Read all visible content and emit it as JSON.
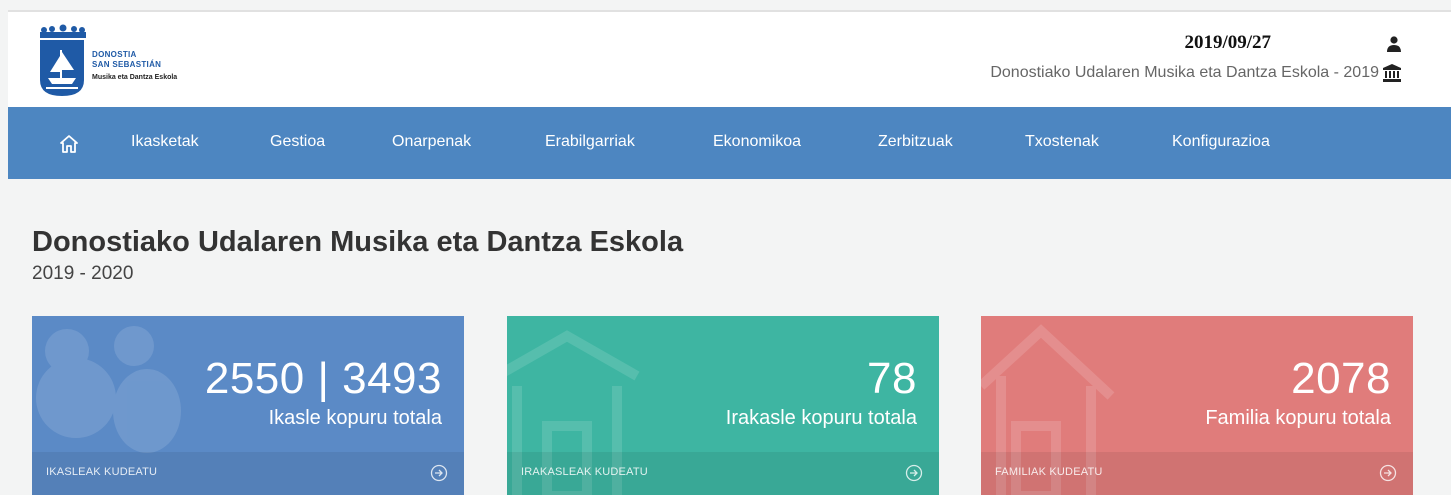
{
  "header": {
    "logo": {
      "line1": "DONOSTIA",
      "line2": "SAN SEBASTIÁN",
      "line3": "Musika eta Dantza Eskola"
    },
    "date": "2019/09/27",
    "subtitle": "Donostiako Udalaren Musika eta Dantza Eskola - 2019",
    "icons": [
      "user-icon",
      "bank-icon"
    ]
  },
  "nav": {
    "home_icon": "home-icon",
    "items": [
      "Ikasketak",
      "Gestioa",
      "Onarpenak",
      "Erabilgarriak",
      "Ekonomikoa",
      "Zerbitzuak",
      "Txostenak",
      "Konfigurazioa"
    ]
  },
  "main": {
    "title": "Donostiako Udalaren Musika eta Dantza Eskola",
    "subtitle": "2019 - 2020"
  },
  "cards": [
    {
      "value": "2550 | 3493",
      "label": "Ikasle kopuru totala",
      "action": "IKASLEAK KUDEATU",
      "color": "#5b8ac6",
      "icon": "people-icon"
    },
    {
      "value": "78",
      "label": "Irakasle kopuru totala",
      "action": "IRAKASLEAK KUDEATU",
      "color": "#3eb5a2",
      "icon": "school-icon"
    },
    {
      "value": "2078",
      "label": "Familia kopuru totala",
      "action": "FAMILIAK KUDEATU",
      "color": "#e07c7b",
      "icon": "house-icon"
    }
  ],
  "colors": {
    "navbar": "#4d86c1",
    "background": "#f3f4f4"
  }
}
